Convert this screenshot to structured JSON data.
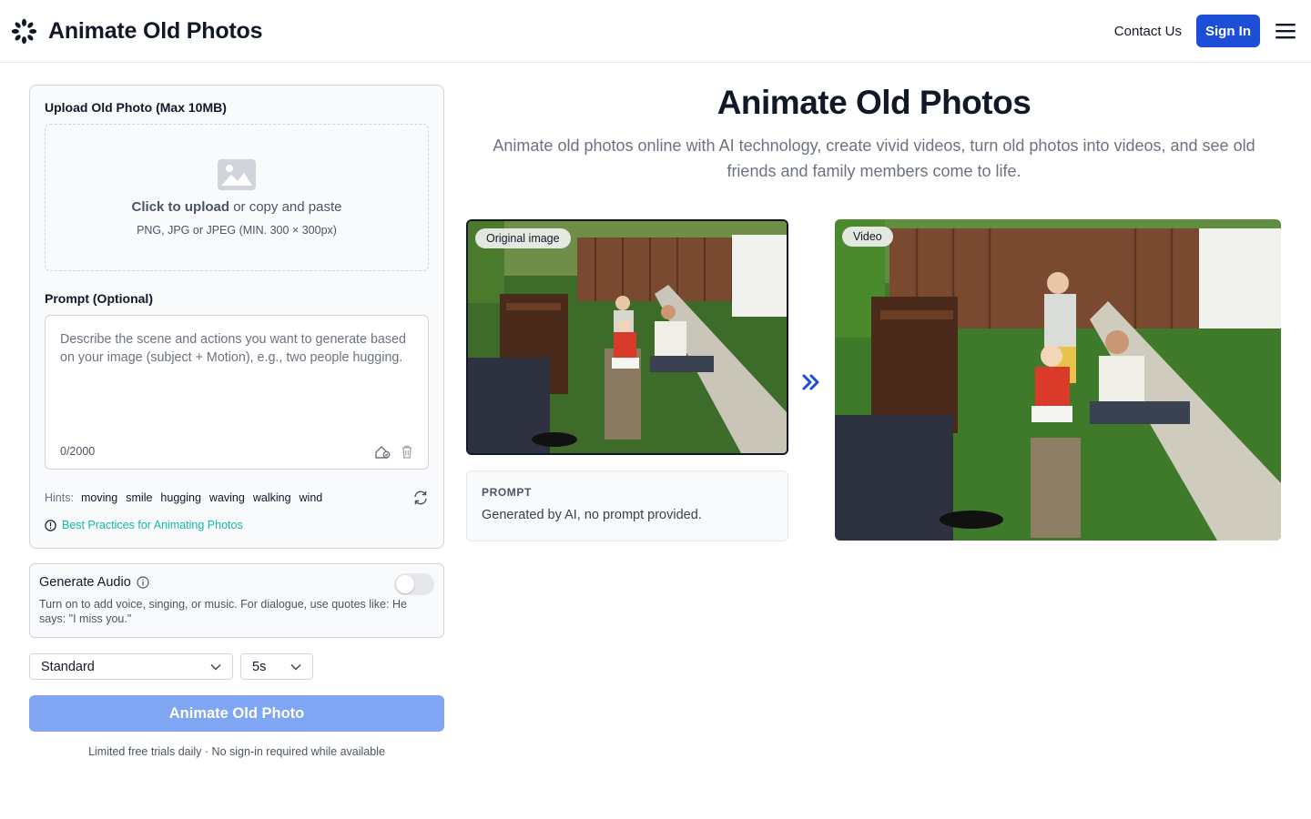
{
  "header": {
    "brand_name": "Animate Old Photos",
    "contact_label": "Contact Us",
    "signin_label": "Sign In"
  },
  "upload": {
    "label": "Upload Old Photo (Max 10MB)",
    "click_label": "Click to upload",
    "or_label": " or copy and paste",
    "formats": "PNG, JPG or JPEG (MIN. 300 × 300px)"
  },
  "prompt": {
    "label": "Prompt (Optional)",
    "placeholder": "Describe the scene and actions you want to generate based on your image (subject + Motion), e.g., two people hugging.",
    "counter": "0/2000"
  },
  "hints": {
    "label": "Hints:",
    "items": [
      "moving",
      "smile",
      "hugging",
      "waving",
      "walking",
      "wind"
    ]
  },
  "best_practices_label": "Best Practices for Animating Photos",
  "audio": {
    "title": "Generate Audio",
    "description": "Turn on to add voice, singing, or music. For dialogue, use quotes like: He says: \"I miss you.\"",
    "enabled": false
  },
  "options": {
    "quality": "Standard",
    "duration": "5s"
  },
  "animate_button": "Animate Old Photo",
  "trial_note": "Limited free trials daily · No sign-in required while available",
  "hero": {
    "title": "Animate Old Photos",
    "subtitle": "Animate old photos online with AI technology, create vivid videos, turn old photos into videos, and see old friends and family members come to life."
  },
  "showcase": {
    "original_badge": "Original image",
    "video_badge": "Video",
    "prompt_title": "PROMPT",
    "prompt_text": "Generated by AI, no prompt provided."
  },
  "colors": {
    "primary": "#1d4ed8",
    "button_disabled": "#7fa5f3",
    "link_teal": "#14b8a6"
  }
}
